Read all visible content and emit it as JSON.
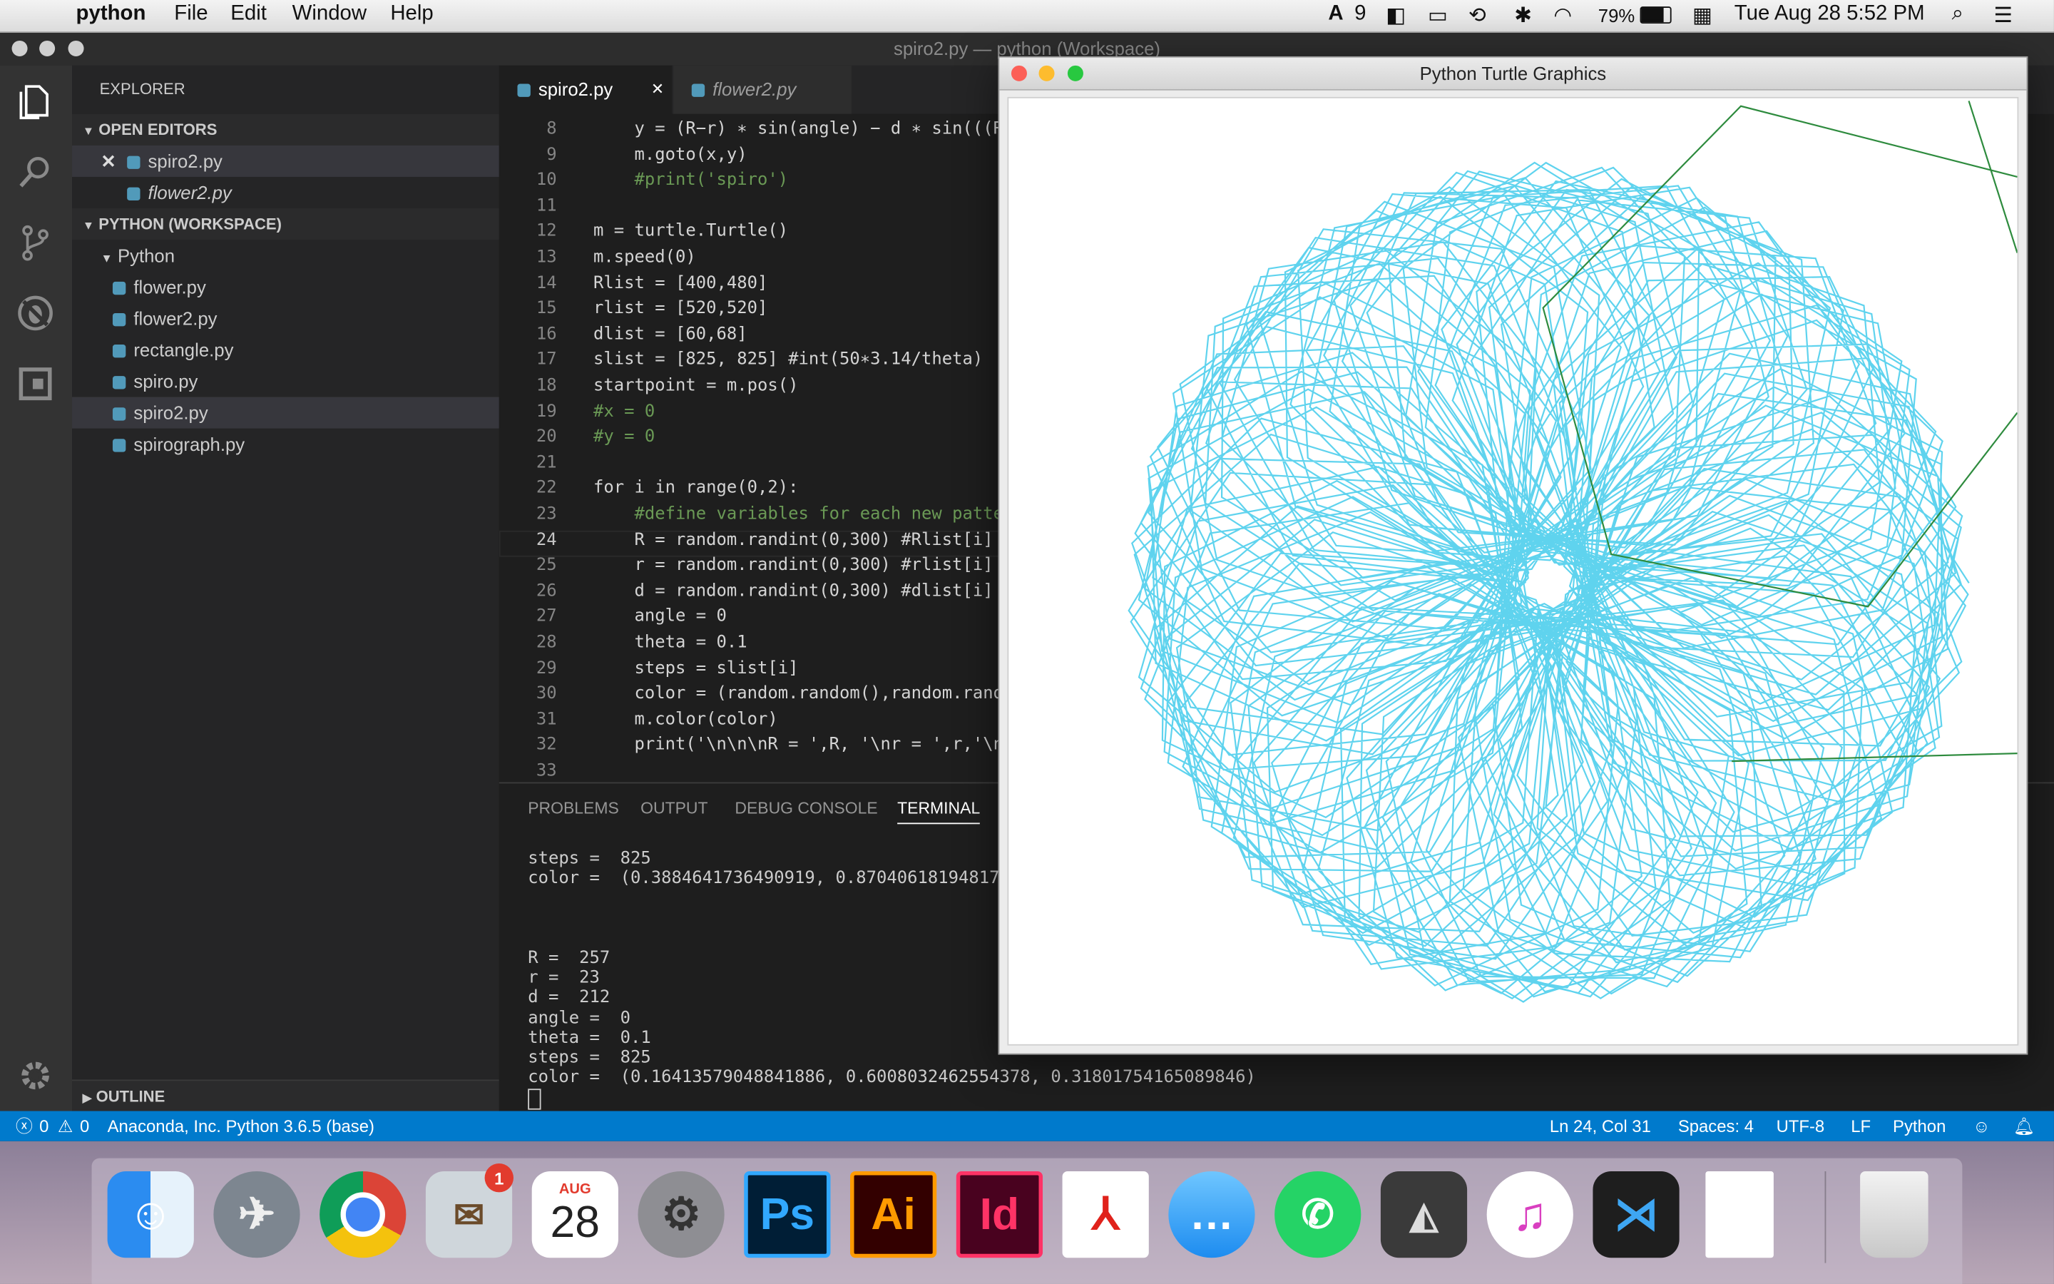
{
  "menubar": {
    "app_name": "python",
    "items": [
      "File",
      "Edit",
      "Window",
      "Help"
    ],
    "status_items": {
      "adobe_count": "9",
      "battery": "79%",
      "datetime": "Tue Aug 28  5:52 PM"
    }
  },
  "window": {
    "title": "spiro2.py — python (Workspace)"
  },
  "sidebar": {
    "header": "EXPLORER",
    "open_editors_label": "OPEN EDITORS",
    "open_editors": [
      "spiro2.py",
      "flower2.py"
    ],
    "workspace_label": "PYTHON (WORKSPACE)",
    "folder": "Python",
    "files": [
      "flower.py",
      "flower2.py",
      "rectangle.py",
      "spiro.py",
      "spiro2.py",
      "spirograph.py"
    ],
    "outline_label": "OUTLINE"
  },
  "tabs": [
    {
      "label": "spiro2.py",
      "active": true
    },
    {
      "label": "flower2.py",
      "active": false
    }
  ],
  "editor": {
    "lines": [
      {
        "n": "8",
        "t": "    y = (R−r) ∗ sin(angle) − d ∗ sin(((R"
      },
      {
        "n": "9",
        "t": "    m.goto(x,y)"
      },
      {
        "n": "10",
        "t": "    #print('spiro')"
      },
      {
        "n": "11",
        "t": ""
      },
      {
        "n": "12",
        "t": "m = turtle.Turtle()"
      },
      {
        "n": "13",
        "t": "m.speed(0)"
      },
      {
        "n": "14",
        "t": "Rlist = [400,480]"
      },
      {
        "n": "15",
        "t": "rlist = [520,520]"
      },
      {
        "n": "16",
        "t": "dlist = [60,68]"
      },
      {
        "n": "17",
        "t": "slist = [825, 825] #int(50∗3.14/theta)"
      },
      {
        "n": "18",
        "t": "startpoint = m.pos()"
      },
      {
        "n": "19",
        "t": "#x = 0"
      },
      {
        "n": "20",
        "t": "#y = 0"
      },
      {
        "n": "21",
        "t": ""
      },
      {
        "n": "22",
        "t": "for i in range(0,2):"
      },
      {
        "n": "23",
        "t": "    #define variables for each new patte"
      },
      {
        "n": "24",
        "t": "    R = random.randint(0,300) #Rlist[i]"
      },
      {
        "n": "25",
        "t": "    r = random.randint(0,300) #rlist[i]"
      },
      {
        "n": "26",
        "t": "    d = random.randint(0,300) #dlist[i]"
      },
      {
        "n": "27",
        "t": "    angle = 0"
      },
      {
        "n": "28",
        "t": "    theta = 0.1"
      },
      {
        "n": "29",
        "t": "    steps = slist[i]"
      },
      {
        "n": "30",
        "t": "    color = (random.random(),random.rand"
      },
      {
        "n": "31",
        "t": "    m.color(color)"
      },
      {
        "n": "32",
        "t": "    print('\\n\\n\\nR = ',R, '\\nr = ',r,'\\n"
      },
      {
        "n": "33",
        "t": ""
      }
    ]
  },
  "panel": {
    "tabs": [
      "PROBLEMS",
      "OUTPUT",
      "DEBUG CONSOLE",
      "TERMINAL"
    ],
    "terminal": [
      "steps =  825",
      "color =  (0.3884641736490919, 0.870406181948179",
      "",
      "",
      "",
      "R =  257",
      "r =  23",
      "d =  212",
      "angle =  0",
      "theta =  0.1",
      "steps =  825",
      "color =  (0.16413579048841886, 0.6008032462554378, 0.31801754165089846)"
    ]
  },
  "statusbar": {
    "errors": "0",
    "warnings": "0",
    "interpreter": "Anaconda, Inc. Python 3.6.5 (base)",
    "position": "Ln 24, Col 31",
    "spaces": "Spaces: 4",
    "encoding": "UTF-8",
    "eol": "LF",
    "language": "Python"
  },
  "turtle_window": {
    "title": "Python Turtle Graphics",
    "pattern_color": "#5fd3ee",
    "line_color": "#2e8b3e"
  },
  "dock": {
    "items": [
      "Finder",
      "Launchpad",
      "Chrome",
      "Mail",
      "Calendar",
      "System Preferences",
      "Ps",
      "Ai",
      "Id",
      "Acrobat",
      "Messages",
      "WhatsApp",
      "Rhino",
      "iTunes",
      "VS Code",
      "Document",
      "Trash"
    ],
    "mail_badge": "1",
    "calendar_month": "AUG",
    "calendar_day": "28"
  }
}
